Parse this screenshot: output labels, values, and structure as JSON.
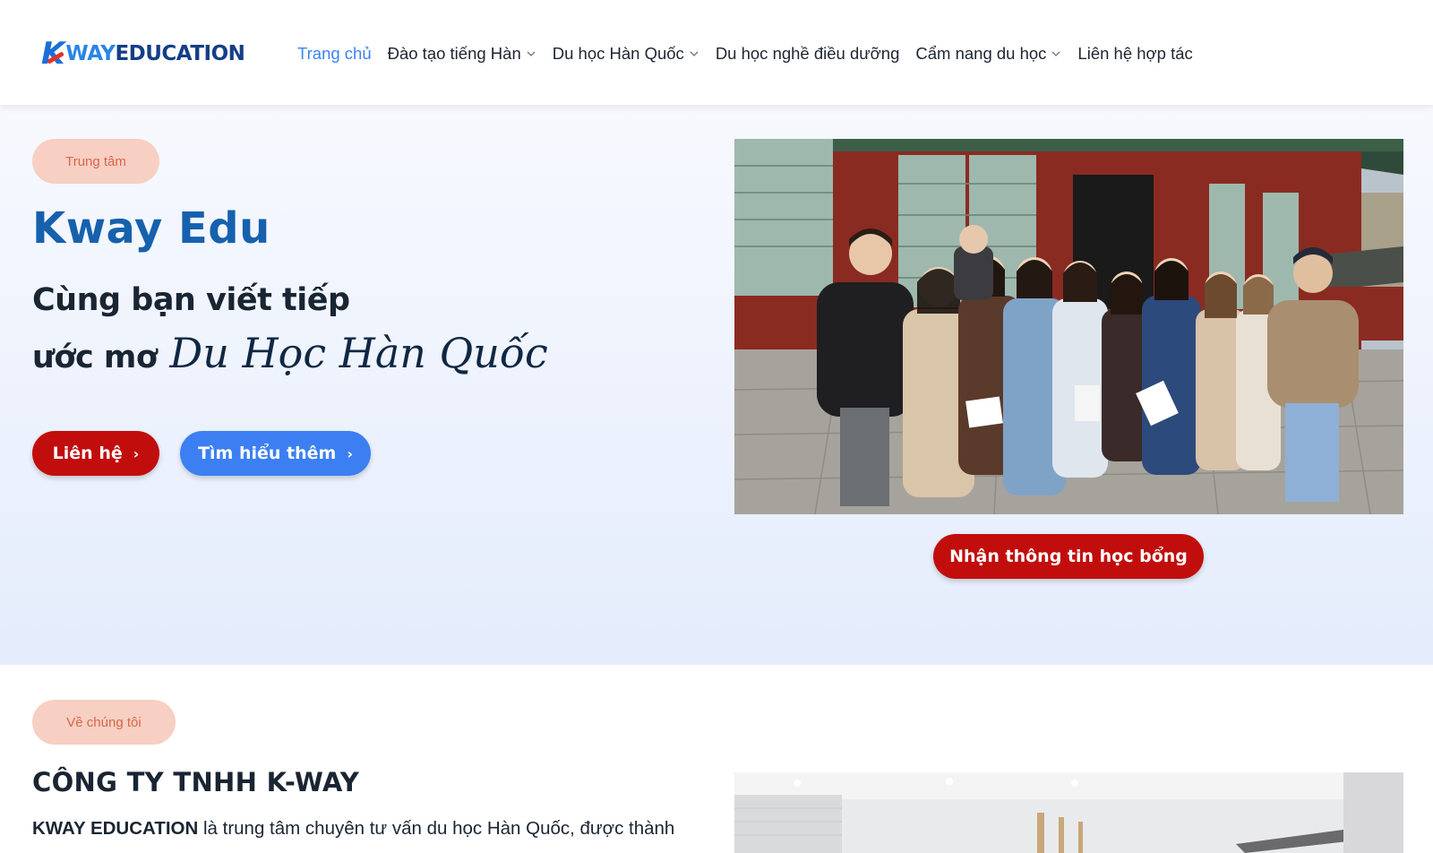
{
  "header": {
    "logo": {
      "k": "K",
      "way": "WAY",
      "edu": "EDUCATION"
    },
    "nav": [
      {
        "label": "Trang chủ",
        "active": true,
        "dropdown": false
      },
      {
        "label": "Đào tạo tiếng Hàn",
        "active": false,
        "dropdown": true
      },
      {
        "label": "Du học Hàn Quốc",
        "active": false,
        "dropdown": true
      },
      {
        "label": "Du học nghề điều dưỡng",
        "active": false,
        "dropdown": false
      },
      {
        "label": "Cẩm nang du học",
        "active": false,
        "dropdown": true
      },
      {
        "label": "Liên hệ hợp tác",
        "active": false,
        "dropdown": false
      }
    ]
  },
  "hero": {
    "badge": "Trung tâm",
    "title": "Kway Edu",
    "line1": "Cùng bạn viết tiếp",
    "line2_plain": "ước mơ",
    "line2_script": "Du Học Hàn Quốc",
    "contact_button": "Liên hệ",
    "more_button": "Tìm hiểu thêm",
    "arrow": "›",
    "scholarship_button": "Nhận thông tin học bổng"
  },
  "about": {
    "badge": "Về chúng tôi",
    "title": "CÔNG TY TNHH K-WAY",
    "text_bold": "KWAY EDUCATION",
    "text_rest": " là trung tâm chuyên tư vấn du học Hàn Quốc, được thành"
  },
  "colors": {
    "brand_blue": "#1661ad",
    "nav_active": "#3b82f6",
    "cta_red": "#c20d0d",
    "cta_blue": "#3b7ff2",
    "badge_bg": "#f7cfc3",
    "badge_text": "#d9664a"
  },
  "icons": {
    "dropdown": "chevron-down-icon",
    "button_arrow": "chevron-right-icon"
  }
}
